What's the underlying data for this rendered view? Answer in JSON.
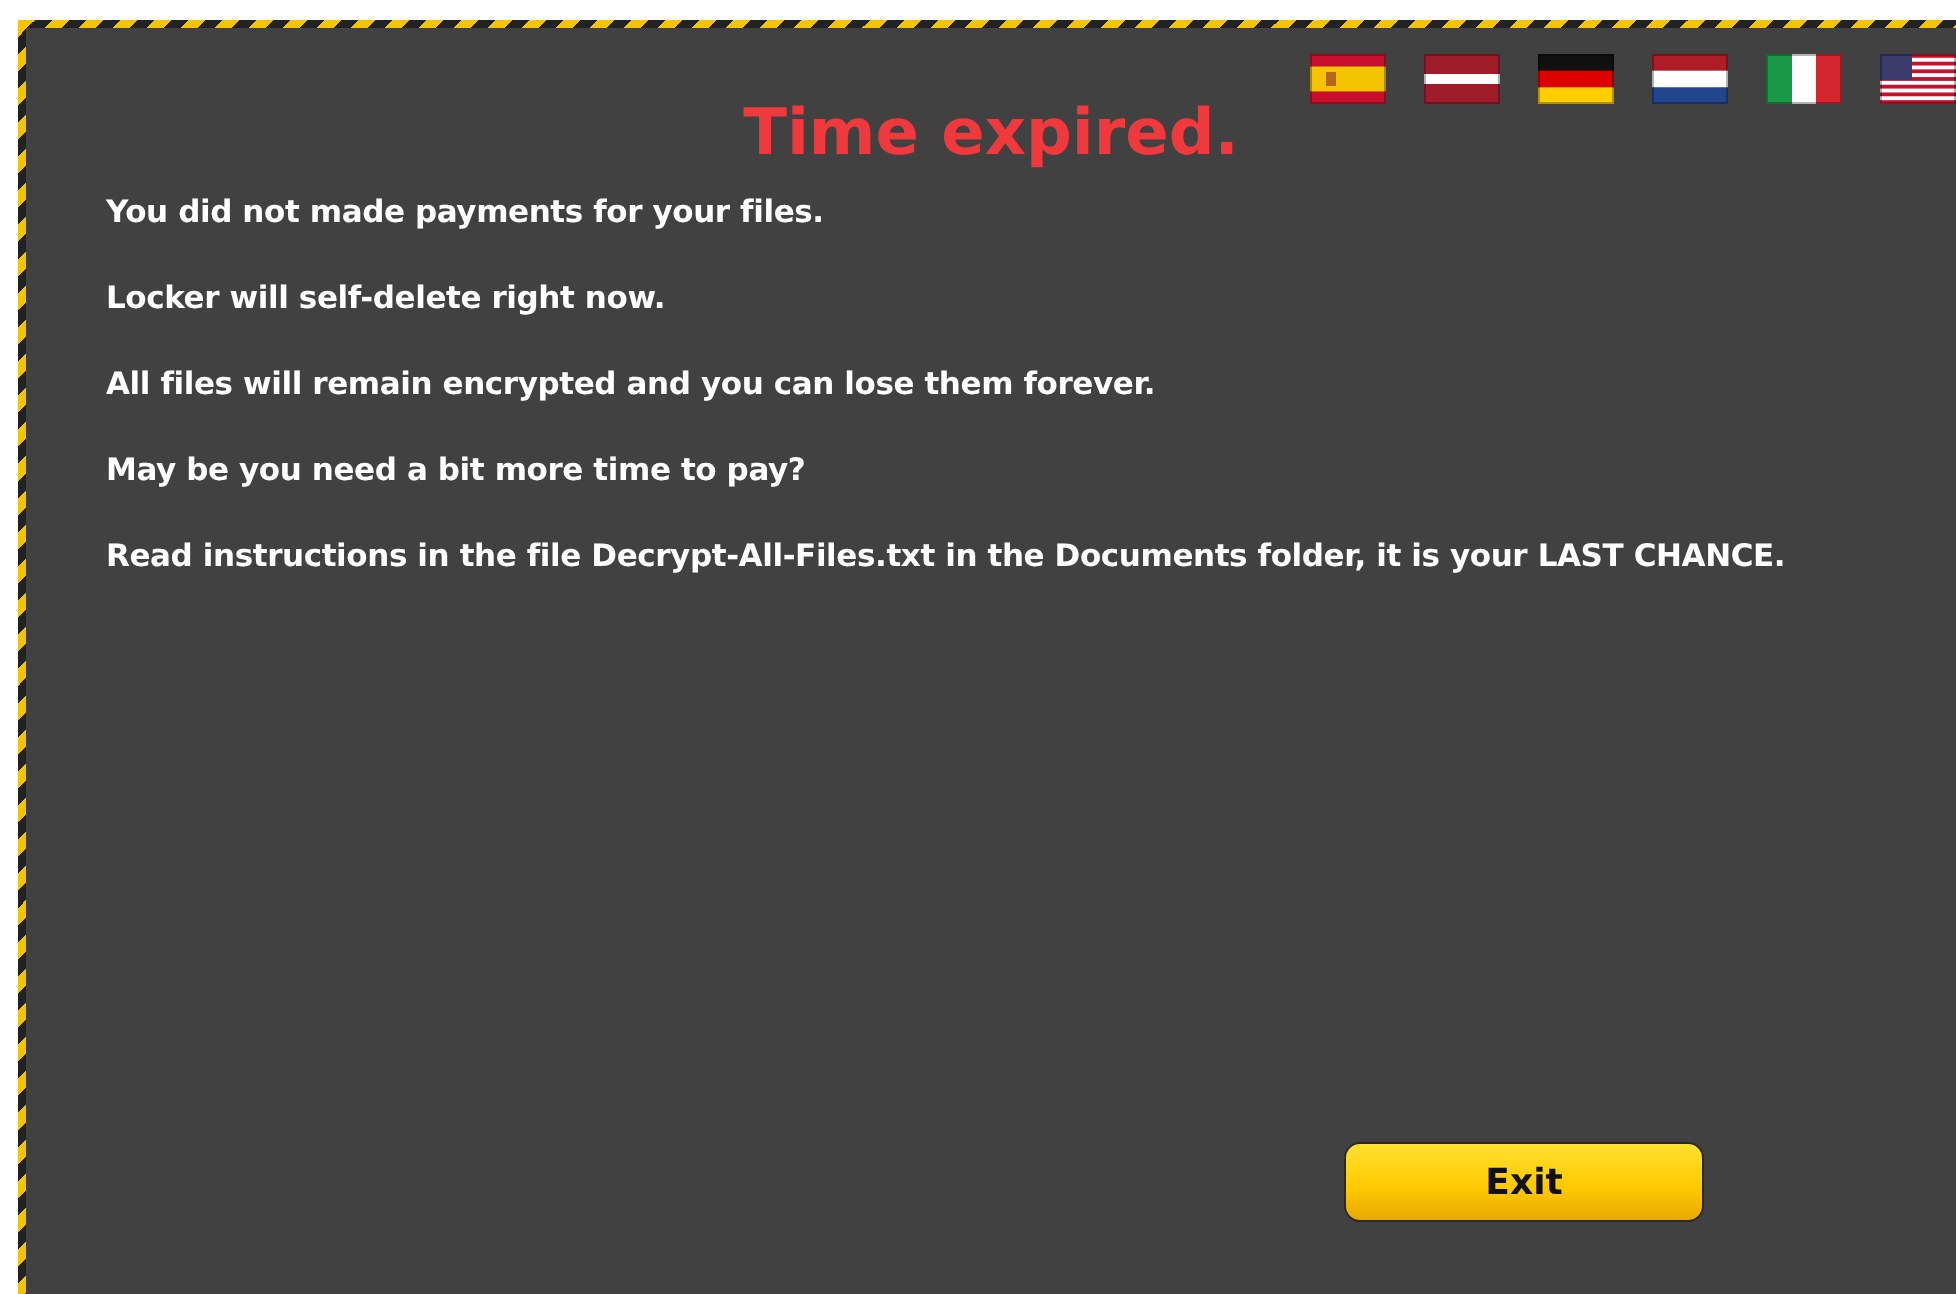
{
  "languages": [
    {
      "kind": "es"
    },
    {
      "kind": "lv"
    },
    {
      "kind": "de"
    },
    {
      "kind": "nl"
    },
    {
      "kind": "it"
    },
    {
      "kind": "us"
    }
  ],
  "title": "Time expired.",
  "messages": [
    "You did not made payments for your files.",
    "Locker will self-delete right now.",
    "All files will remain encrypted and you can lose them forever.",
    "May be you need a bit more time to pay?",
    "Read instructions in the file Decrypt-All-Files.txt in the Documents folder, it is your LAST CHANCE."
  ],
  "exit_button": "Exit"
}
